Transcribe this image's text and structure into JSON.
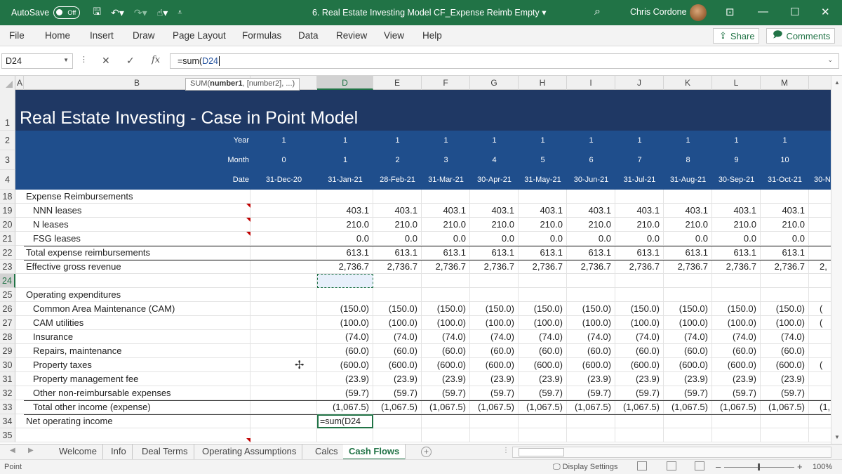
{
  "titlebar": {
    "autosave_label": "AutoSave",
    "autosave_state": "Off",
    "document_title": "6. Real Estate Investing Model CF_Expense Reimb Empty",
    "title_dropdown": "▾",
    "user_name": "Chris Cordone",
    "minimize": "—",
    "restore": "☐",
    "close": "✕",
    "ribbon_display": "⊡"
  },
  "menu": {
    "items": [
      "File",
      "Home",
      "Insert",
      "Draw",
      "Page Layout",
      "Formulas",
      "Data",
      "Review",
      "View",
      "Help"
    ],
    "share_label": "Share",
    "comments_label": "Comments"
  },
  "formula_bar": {
    "name_box": "D24",
    "fx": "fx",
    "formula_prefix": "=sum(",
    "formula_ref": "D24",
    "tooltip_fn": "SUM(",
    "tooltip_arg1": "number1",
    "tooltip_rest": ", [number2], ...)"
  },
  "columns": [
    "A",
    "B",
    "",
    "D",
    "E",
    "F",
    "G",
    "H",
    "I",
    "J",
    "K",
    "L",
    "M"
  ],
  "sheet": {
    "title": "Real Estate Investing - Case in Point Model",
    "year_label": "Year",
    "month_label": "Month",
    "date_label": "Date",
    "c_year": "1",
    "c_month": "0",
    "c_date": "31-Dec-20",
    "years": [
      "1",
      "1",
      "1",
      "1",
      "1",
      "1",
      "1",
      "1",
      "1",
      "1"
    ],
    "months": [
      "1",
      "2",
      "3",
      "4",
      "5",
      "6",
      "7",
      "8",
      "9",
      "10"
    ],
    "dates": [
      "31-Jan-21",
      "28-Feb-21",
      "31-Mar-21",
      "30-Apr-21",
      "31-May-21",
      "30-Jun-21",
      "31-Jul-21",
      "31-Aug-21",
      "30-Sep-21",
      "31-Oct-21"
    ],
    "date_overflow": "30-N"
  },
  "rows": [
    {
      "num": "1"
    },
    {
      "num": "2"
    },
    {
      "num": "3"
    },
    {
      "num": "4"
    },
    {
      "num": "18",
      "label": "Expense Reimbursements",
      "indent": 0
    },
    {
      "num": "19",
      "label": "NNN leases",
      "indent": 1,
      "value": "403.1"
    },
    {
      "num": "20",
      "label": "N leases",
      "indent": 1,
      "value": "210.0"
    },
    {
      "num": "21",
      "label": "FSG leases",
      "indent": 1,
      "value": "0.0"
    },
    {
      "num": "22",
      "label": "Total expense reimbursements",
      "indent": 0,
      "value": "613.1"
    },
    {
      "num": "23",
      "label": "Effective gross revenue",
      "indent": 0,
      "value": "2,736.7",
      "overflow": "2,"
    },
    {
      "num": "24"
    },
    {
      "num": "25",
      "label": "Operating expenditures",
      "indent": 0
    },
    {
      "num": "26",
      "label": "Common Area Maintenance (CAM)",
      "indent": 1,
      "value": "(150.0)",
      "overflow": "("
    },
    {
      "num": "27",
      "label": "CAM utilities",
      "indent": 1,
      "value": "(100.0)",
      "overflow": "("
    },
    {
      "num": "28",
      "label": "Insurance",
      "indent": 1,
      "value": "(74.0)"
    },
    {
      "num": "29",
      "label": "Repairs, maintenance",
      "indent": 1,
      "value": "(60.0)"
    },
    {
      "num": "30",
      "label": "Property taxes",
      "indent": 1,
      "value": "(600.0)",
      "overflow": "("
    },
    {
      "num": "31",
      "label": "Property management fee",
      "indent": 1,
      "value": "(23.9)"
    },
    {
      "num": "32",
      "label": "Other non-reimbursable expenses",
      "indent": 1,
      "value": "(59.7)"
    },
    {
      "num": "33",
      "label": "Total other income (expense)",
      "indent": 1,
      "value": "(1,067.5)",
      "overflow": "(1,"
    },
    {
      "num": "34",
      "label": "Net operating income",
      "indent": 0
    },
    {
      "num": "35"
    }
  ],
  "editing_cell_text": "=sum(D24",
  "tabs": [
    "Welcome",
    "Info",
    "Deal Terms",
    "Operating Assumptions",
    "Calcs",
    "Cash Flows"
  ],
  "active_tab": "Cash Flows",
  "status": {
    "mode": "Point",
    "display_settings": "Display Settings",
    "zoom": "100%"
  },
  "colors": {
    "accent": "#217346",
    "title_band": "#1f3864",
    "header_band": "#1f4e8c"
  }
}
